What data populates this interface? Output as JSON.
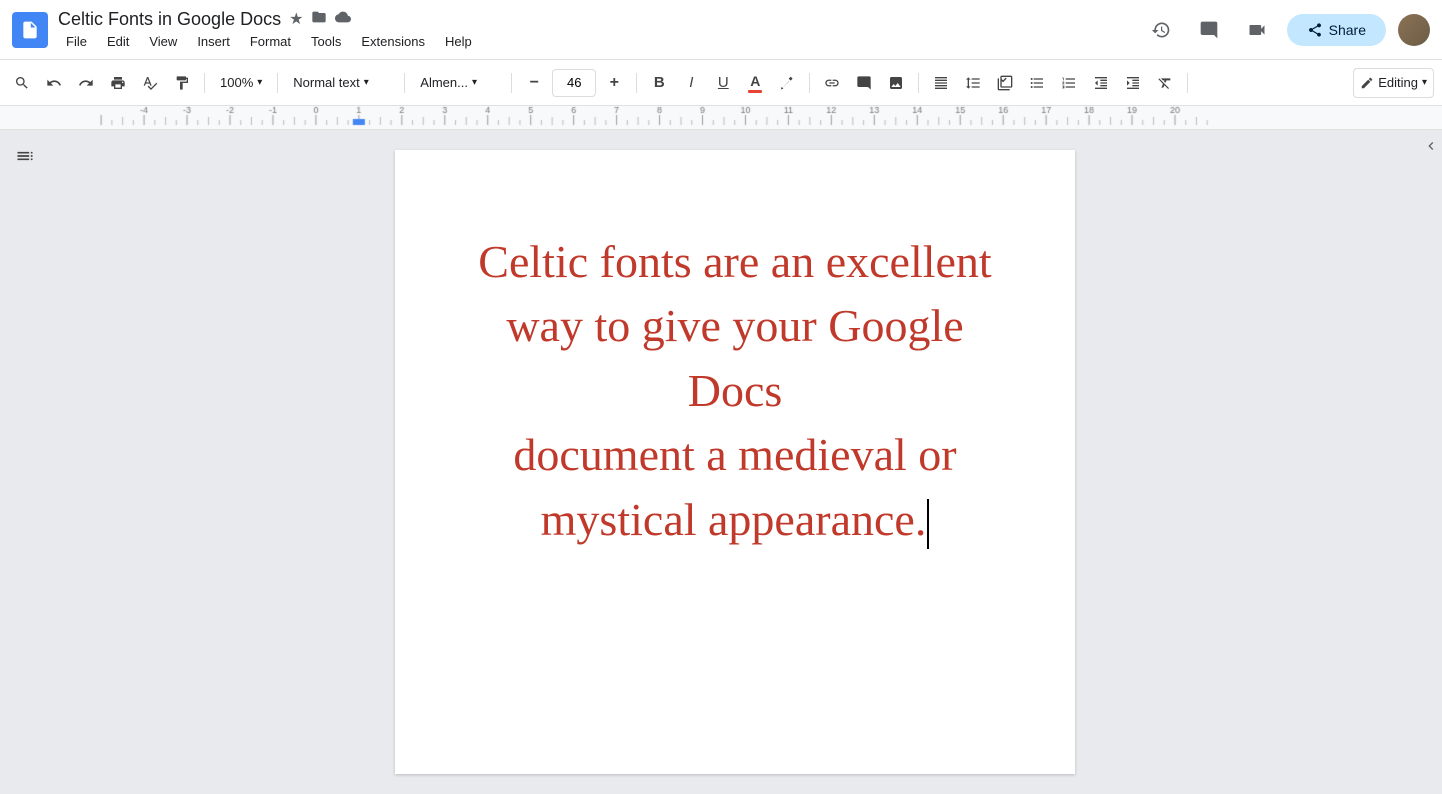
{
  "titleBar": {
    "docTitle": "Celtic Fonts in Google Docs",
    "starIcon": "★",
    "folderIcon": "📁",
    "cloudIcon": "☁",
    "menuItems": [
      "File",
      "Edit",
      "View",
      "Insert",
      "Format",
      "Tools",
      "Extensions",
      "Help"
    ],
    "shareLabel": "Share",
    "historyIcon": "⏱",
    "commentsIcon": "💬",
    "meetIcon": "📹"
  },
  "toolbar": {
    "searchIcon": "🔍",
    "undoIcon": "↺",
    "redoIcon": "↻",
    "printIcon": "🖨",
    "spellcheckIcon": "✓",
    "paintFormatIcon": "🖌",
    "zoomValue": "100%",
    "zoomDropdown": "▾",
    "textStyleValue": "Normal text",
    "textStyleDropdown": "▾",
    "fontFamilyValue": "Almen...",
    "fontFamilyDropdown": "▾",
    "decreaseFontIcon": "−",
    "fontSizeValue": "46",
    "increaseFontIcon": "+",
    "boldLabel": "B",
    "italicLabel": "I",
    "underlineLabel": "U",
    "textColorLabel": "A",
    "highlightLabel": "🖊",
    "linkLabel": "🔗",
    "commentLabel": "💬",
    "imageLabel": "🖼",
    "alignLabel": "≡",
    "lineSpacingLabel": "↕",
    "bulletListLabel": "☰",
    "numberedListLabel": "⊟",
    "decreaseIndentLabel": "⇤",
    "increaseIndentLabel": "⇥",
    "clearFormattingLabel": "✕",
    "editingModeLabel": "✏",
    "editingModeDropdown": "▾",
    "collapseLabel": "∧"
  },
  "document": {
    "mainText": "Celtic fonts are an excellent way to give your Google Docs document a medieval or mystical appearance.",
    "line1": "Celtic fonts are an excellent",
    "line2": "way to give your Google Docs",
    "line3": "document a medieval or",
    "line4": "mystical appearance.",
    "textColor": "#c0392b"
  },
  "sidebar": {
    "outlineIcon": "≡"
  }
}
